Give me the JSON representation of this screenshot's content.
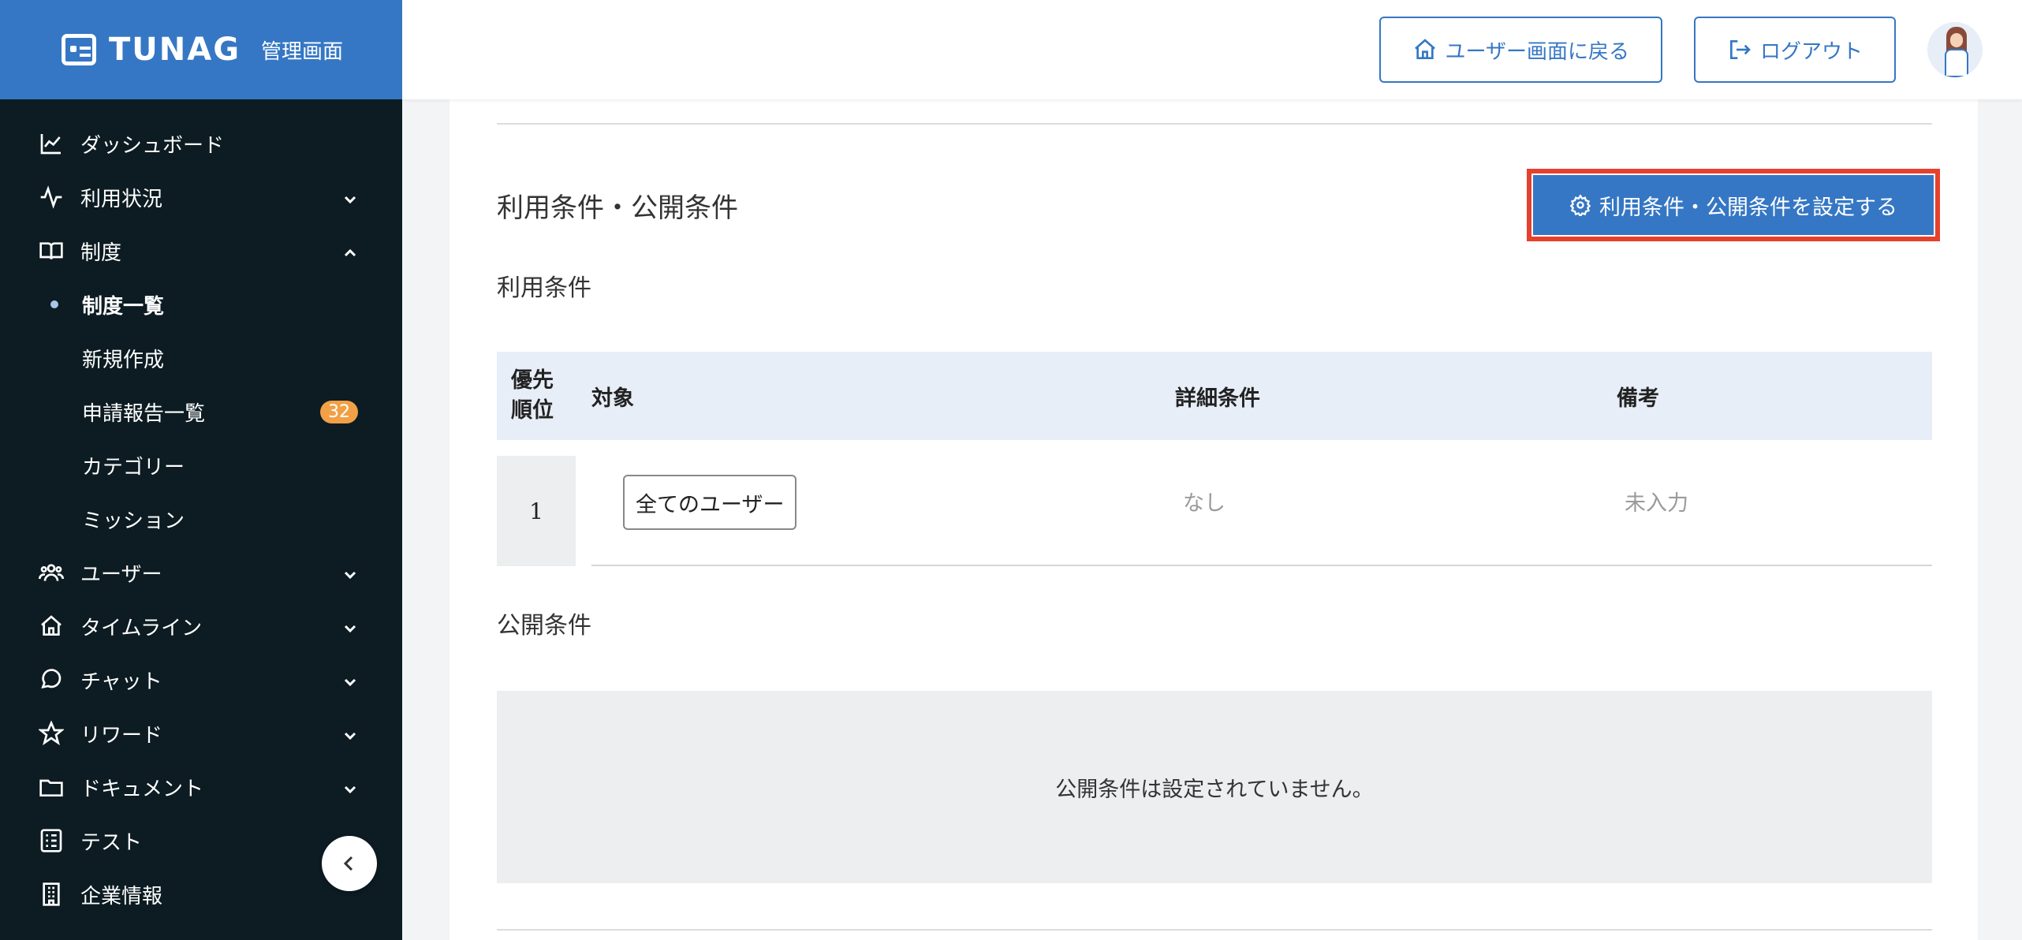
{
  "brand": {
    "name": "TUNAG",
    "sub": "管理画面"
  },
  "header": {
    "back_label": "ユーザー画面に戻る",
    "logout_label": "ログアウト"
  },
  "sidebar": {
    "items": [
      {
        "label": "ダッシュボード",
        "icon": "chart-line-icon"
      },
      {
        "label": "利用状況",
        "icon": "pulse-icon"
      },
      {
        "label": "制度",
        "icon": "book-icon"
      },
      {
        "label": "ユーザー",
        "icon": "users-icon"
      },
      {
        "label": "タイムライン",
        "icon": "home-icon"
      },
      {
        "label": "チャット",
        "icon": "chat-icon"
      },
      {
        "label": "リワード",
        "icon": "star-icon"
      },
      {
        "label": "ドキュメント",
        "icon": "folder-icon"
      },
      {
        "label": "テスト",
        "icon": "checklist-icon"
      },
      {
        "label": "企業情報",
        "icon": "building-icon"
      }
    ],
    "sub_items": [
      {
        "label": "制度一覧"
      },
      {
        "label": "新規作成"
      },
      {
        "label": "申請報告一覧",
        "badge": "32"
      },
      {
        "label": "カテゴリー"
      },
      {
        "label": "ミッション"
      }
    ]
  },
  "main": {
    "section_title": "利用条件・公開条件",
    "setting_button": "利用条件・公開条件を設定する",
    "usage_title": "利用条件",
    "table": {
      "headers": {
        "priority": "優先\n順位",
        "target": "対象",
        "detail": "詳細条件",
        "note": "備考"
      },
      "rows": [
        {
          "priority": "1",
          "target": "全てのユーザー",
          "detail": "なし",
          "note": "未入力"
        }
      ]
    },
    "public_title": "公開条件",
    "public_empty": "公開条件は設定されていません。"
  },
  "colors": {
    "accent": "#3577c4",
    "sidebar_bg": "#0c1c22",
    "highlight": "#e5412c",
    "badge": "#f1a046"
  }
}
